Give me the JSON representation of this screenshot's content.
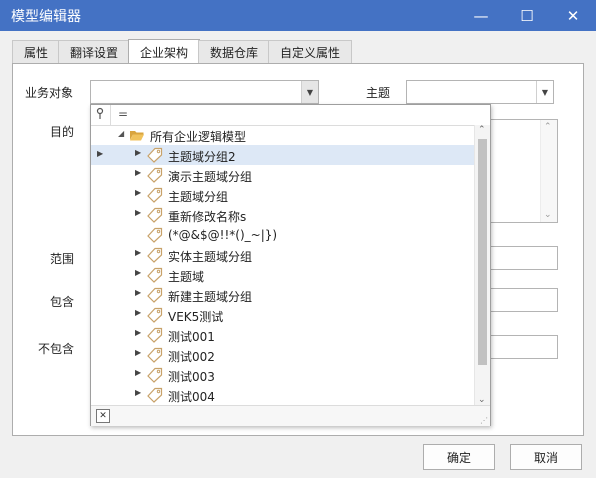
{
  "window": {
    "title": "模型编辑器",
    "minimize_glyph": "—",
    "maximize_glyph": "☐",
    "close_glyph": "✕"
  },
  "tabs": [
    {
      "label": "属性",
      "active": false
    },
    {
      "label": "翻译设置",
      "active": false
    },
    {
      "label": "企业架构",
      "active": true
    },
    {
      "label": "数据仓库",
      "active": false
    },
    {
      "label": "自定义属性",
      "active": false
    }
  ],
  "form": {
    "business_object_label": "业务对象",
    "business_object_value": "",
    "subject_label": "主题",
    "subject_value": "",
    "purpose_label": "目的",
    "scope_label": "范围",
    "include_label": "包含",
    "exclude_label": "不包含"
  },
  "popup": {
    "search_value": "",
    "root": {
      "label": "所有企业逻辑模型",
      "icon": "open-folder-icon"
    },
    "items": [
      {
        "label": "主题域分组2",
        "has_children": true,
        "selected": true
      },
      {
        "label": "演示主题域分组",
        "has_children": true,
        "selected": false
      },
      {
        "label": "主题域分组",
        "has_children": true,
        "selected": false
      },
      {
        "label": "重新修改名称s",
        "has_children": true,
        "selected": false
      },
      {
        "label": "(*@&$@!!*()_~|})",
        "has_children": false,
        "selected": false
      },
      {
        "label": "实体主题域分组",
        "has_children": true,
        "selected": false
      },
      {
        "label": "主题域",
        "has_children": true,
        "selected": false
      },
      {
        "label": "新建主题域分组",
        "has_children": true,
        "selected": false
      },
      {
        "label": "VEK5测试",
        "has_children": true,
        "selected": false
      },
      {
        "label": "测试001",
        "has_children": true,
        "selected": false
      },
      {
        "label": "测试002",
        "has_children": true,
        "selected": false
      },
      {
        "label": "测试003",
        "has_children": true,
        "selected": false
      },
      {
        "label": "测试004",
        "has_children": true,
        "selected": false
      }
    ],
    "item_icon": "tag-icon",
    "close_glyph": "✕"
  },
  "buttons": {
    "ok": "确定",
    "cancel": "取消"
  },
  "colors": {
    "titlebar": "#4472c4",
    "selected_row": "#dde8f6",
    "folder": "#e8b04a",
    "tag": "#c8a26a"
  }
}
